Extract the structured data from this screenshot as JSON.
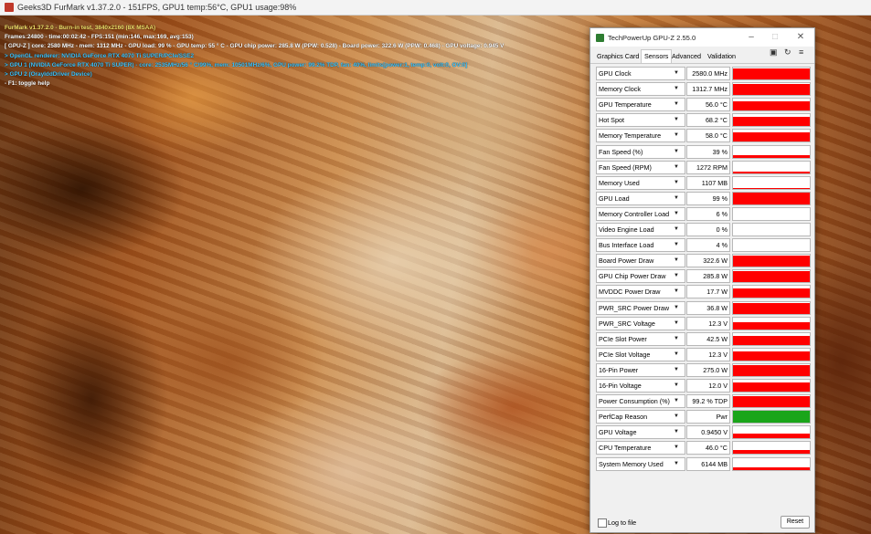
{
  "furmark": {
    "title": "Geeks3D FurMark v1.37.2.0 - 151FPS, GPU1 temp:56°C, GPU1 usage:98%",
    "osd": [
      "FurMark v1.37.2.0 - Burn-in test, 3840x2160 (8X MSAA)",
      "Frames:24800 - time:00:02:42 - FPS:151 (min:146, max:169, avg:153)",
      "[ GPU-Z ] core: 2580 MHz - mem: 1312 MHz - GPU load: 99 % - GPU temp: 55 ° C - GPU chip power: 285.8 W (PPW: 0.528) - Board power: 322.6 W (PPW: 0.468) - GPU voltage: 0.945 V",
      "> OpenGL renderer: NVIDIA GeForce RTX 4070 Ti SUPER/PCIe/SSE2",
      "> GPU 1 (NVIDIA GeForce RTX 4070 Ti SUPER) - core: 2535MHz/56 ° C/99%, mem: 10501MHz/6%, GPU power: 99.2% TDP, fan: 40%, limits[power:1, temp:0, volt:0, OV:0]",
      "> GPU 2 (OrayIddDriver Device)",
      "- F1: toggle help"
    ]
  },
  "gpuz": {
    "title": "TechPowerUp GPU-Z 2.55.0",
    "tabs": [
      "Graphics Card",
      "Sensors",
      "Advanced",
      "Validation"
    ],
    "active_tab": "Sensors",
    "sensors": [
      {
        "label": "GPU Clock",
        "value": "2580.0 MHz",
        "level": 0.9
      },
      {
        "label": "Memory Clock",
        "value": "1312.7 MHz",
        "level": 0.9
      },
      {
        "label": "GPU Temperature",
        "value": "56.0 °C",
        "level": 0.75
      },
      {
        "label": "Hot Spot",
        "value": "68.2 °C",
        "level": 0.75
      },
      {
        "label": "Memory Temperature",
        "value": "58.0 °C",
        "level": 0.75
      },
      {
        "label": "Fan Speed (%)",
        "value": "39 %",
        "level": 0.25
      },
      {
        "label": "Fan Speed (RPM)",
        "value": "1272 RPM",
        "level": 0.15
      },
      {
        "label": "Memory Used",
        "value": "1107 MB",
        "level": 0.08
      },
      {
        "label": "GPU Load",
        "value": "99 %",
        "level": 0.99
      },
      {
        "label": "Memory Controller Load",
        "value": "6 %",
        "level": 0.0
      },
      {
        "label": "Video Engine Load",
        "value": "0 %",
        "level": 0.0
      },
      {
        "label": "Bus Interface Load",
        "value": "4 %",
        "level": 0.0
      },
      {
        "label": "Board Power Draw",
        "value": "322.6 W",
        "level": 0.9
      },
      {
        "label": "GPU Chip Power Draw",
        "value": "285.8 W",
        "level": 0.9
      },
      {
        "label": "MVDDC Power Draw",
        "value": "17.7 W",
        "level": 0.75
      },
      {
        "label": "PWR_SRC Power Draw",
        "value": "36.8 W",
        "level": 0.9
      },
      {
        "label": "PWR_SRC Voltage",
        "value": "12.3 V",
        "level": 0.6
      },
      {
        "label": "PCIe Slot Power",
        "value": "42.5 W",
        "level": 0.8
      },
      {
        "label": "PCIe Slot Voltage",
        "value": "12.3 V",
        "level": 0.75
      },
      {
        "label": "16-Pin Power",
        "value": "275.0 W",
        "level": 0.9
      },
      {
        "label": "16-Pin Voltage",
        "value": "12.0 V",
        "level": 0.75
      },
      {
        "label": "Power Consumption (%)",
        "value": "99.2 % TDP",
        "level": 0.9
      },
      {
        "label": "PerfCap Reason",
        "value": "Pwr",
        "level": 1.0,
        "color": "#1aa51a"
      },
      {
        "label": "GPU Voltage",
        "value": "0.9450 V",
        "level": 0.35
      },
      {
        "label": "CPU Temperature",
        "value": "46.0 °C",
        "level": 0.3
      },
      {
        "label": "System Memory Used",
        "value": "6144 MB",
        "level": 0.2
      }
    ],
    "graph_color": "#ff0000",
    "log_to_file_label": "Log to file",
    "reset_label": "Reset",
    "icons": [
      "camera-icon",
      "refresh-icon",
      "menu-icon"
    ]
  }
}
